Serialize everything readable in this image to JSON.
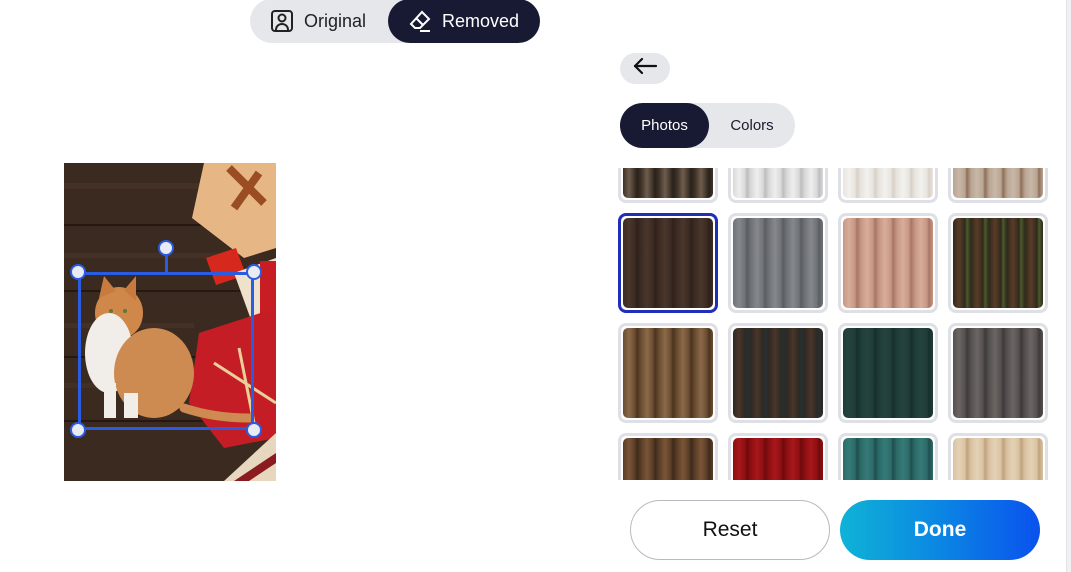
{
  "view_toggle": {
    "options": [
      {
        "label": "Original",
        "icon": "portrait-icon",
        "active": false
      },
      {
        "label": "Removed",
        "icon": "eraser-icon",
        "active": true
      }
    ]
  },
  "panel": {
    "back_icon": "arrow-left-icon",
    "tabs": [
      {
        "label": "Photos",
        "active": true
      },
      {
        "label": "Colors",
        "active": false
      }
    ],
    "backgrounds": [
      {
        "name": "stone-mat",
        "colors": [
          "#3d3128",
          "#6e5d4d",
          "#2a221b"
        ],
        "selected": false
      },
      {
        "name": "white-weathered-wood",
        "colors": [
          "#d9d9d9",
          "#eeeeee",
          "#bdbdbd"
        ],
        "selected": false
      },
      {
        "name": "light-whitewash-wood",
        "colors": [
          "#e8e4df",
          "#f3f1ee",
          "#d8d0c8"
        ],
        "selected": false
      },
      {
        "name": "pale-brown-wood",
        "colors": [
          "#b9a592",
          "#c8b7a8",
          "#8e6f58"
        ],
        "selected": false
      },
      {
        "name": "dark-wood-with-gifts",
        "colors": [
          "#3c2b22",
          "#4a372c",
          "#2e221b"
        ],
        "selected": true
      },
      {
        "name": "grey-wood",
        "colors": [
          "#6f7277",
          "#85888c",
          "#5a5d61"
        ],
        "selected": false
      },
      {
        "name": "diagonal-pink-wood",
        "colors": [
          "#c59684",
          "#d9ad9a",
          "#a97564"
        ],
        "selected": false
      },
      {
        "name": "log-cabin",
        "colors": [
          "#2f2a1c",
          "#5a3c28",
          "#4b5a2c"
        ],
        "selected": false
      },
      {
        "name": "brown-knot-wood",
        "colors": [
          "#6a4c30",
          "#8a6a48",
          "#4a3420"
        ],
        "selected": false
      },
      {
        "name": "dark-wood-with-leaf",
        "colors": [
          "#2e2926",
          "#4a3528",
          "#26302e"
        ],
        "selected": false
      },
      {
        "name": "dark-green-texture",
        "colors": [
          "#1f3c38",
          "#25433f",
          "#16302c"
        ],
        "selected": false
      },
      {
        "name": "grey-distressed-wood",
        "colors": [
          "#55504f",
          "#6b6563",
          "#3e3a3a"
        ],
        "selected": false
      },
      {
        "name": "dark-brown-plank",
        "colors": [
          "#5a3d27",
          "#7a5538",
          "#3e2a1a"
        ],
        "selected": false
      },
      {
        "name": "red-wood",
        "colors": [
          "#8e0f12",
          "#a8171b",
          "#6e0a0c"
        ],
        "selected": false
      },
      {
        "name": "teal-planks",
        "colors": [
          "#2c6b69",
          "#367a77",
          "#1e4f4d"
        ],
        "selected": false
      },
      {
        "name": "light-tan-wood",
        "colors": [
          "#d9c2a2",
          "#e4d2b6",
          "#bfa27d"
        ],
        "selected": false
      }
    ]
  },
  "actions": {
    "reset_label": "Reset",
    "done_label": "Done"
  },
  "colors": {
    "dark_pill": "#181a33",
    "selection_blue": "#2a5be3",
    "selected_tile_border": "#1f2fb8"
  }
}
